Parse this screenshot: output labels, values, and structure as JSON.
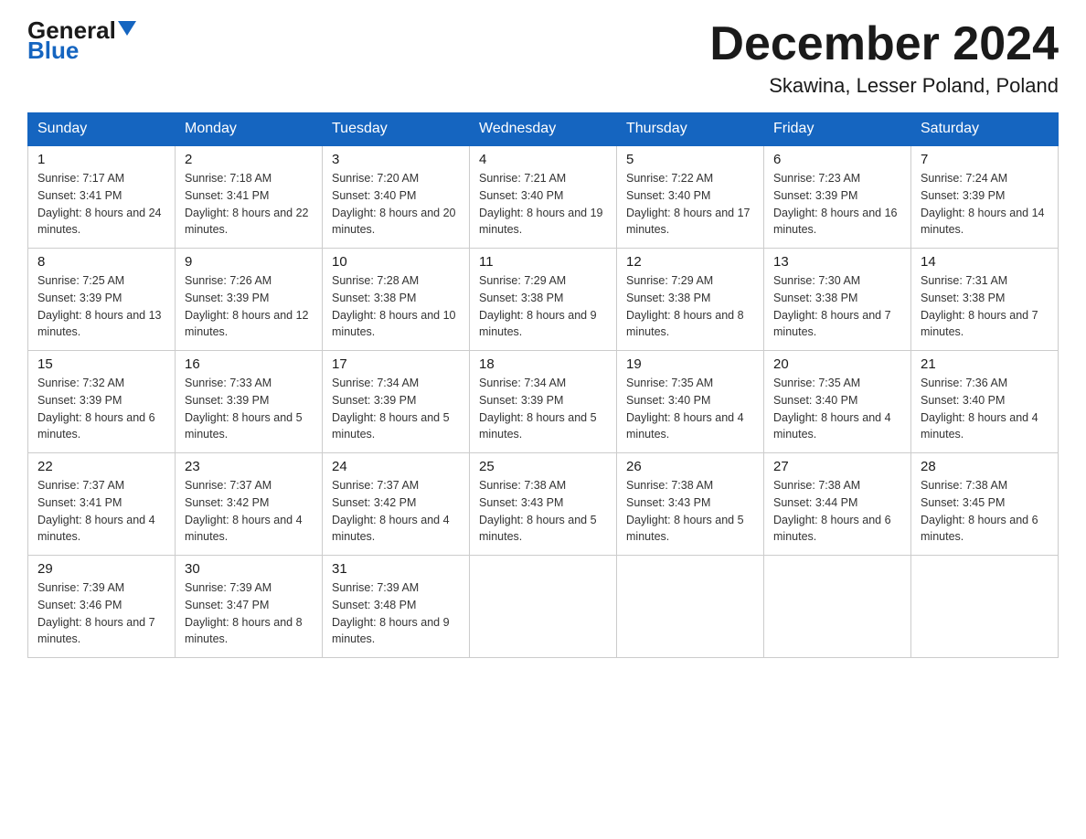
{
  "header": {
    "logo_general": "General",
    "logo_blue": "Blue",
    "title": "December 2024",
    "subtitle": "Skawina, Lesser Poland, Poland"
  },
  "columns": [
    "Sunday",
    "Monday",
    "Tuesday",
    "Wednesday",
    "Thursday",
    "Friday",
    "Saturday"
  ],
  "weeks": [
    [
      {
        "day": "1",
        "sunrise": "7:17 AM",
        "sunset": "3:41 PM",
        "daylight": "8 hours and 24 minutes."
      },
      {
        "day": "2",
        "sunrise": "7:18 AM",
        "sunset": "3:41 PM",
        "daylight": "8 hours and 22 minutes."
      },
      {
        "day": "3",
        "sunrise": "7:20 AM",
        "sunset": "3:40 PM",
        "daylight": "8 hours and 20 minutes."
      },
      {
        "day": "4",
        "sunrise": "7:21 AM",
        "sunset": "3:40 PM",
        "daylight": "8 hours and 19 minutes."
      },
      {
        "day": "5",
        "sunrise": "7:22 AM",
        "sunset": "3:40 PM",
        "daylight": "8 hours and 17 minutes."
      },
      {
        "day": "6",
        "sunrise": "7:23 AM",
        "sunset": "3:39 PM",
        "daylight": "8 hours and 16 minutes."
      },
      {
        "day": "7",
        "sunrise": "7:24 AM",
        "sunset": "3:39 PM",
        "daylight": "8 hours and 14 minutes."
      }
    ],
    [
      {
        "day": "8",
        "sunrise": "7:25 AM",
        "sunset": "3:39 PM",
        "daylight": "8 hours and 13 minutes."
      },
      {
        "day": "9",
        "sunrise": "7:26 AM",
        "sunset": "3:39 PM",
        "daylight": "8 hours and 12 minutes."
      },
      {
        "day": "10",
        "sunrise": "7:28 AM",
        "sunset": "3:38 PM",
        "daylight": "8 hours and 10 minutes."
      },
      {
        "day": "11",
        "sunrise": "7:29 AM",
        "sunset": "3:38 PM",
        "daylight": "8 hours and 9 minutes."
      },
      {
        "day": "12",
        "sunrise": "7:29 AM",
        "sunset": "3:38 PM",
        "daylight": "8 hours and 8 minutes."
      },
      {
        "day": "13",
        "sunrise": "7:30 AM",
        "sunset": "3:38 PM",
        "daylight": "8 hours and 7 minutes."
      },
      {
        "day": "14",
        "sunrise": "7:31 AM",
        "sunset": "3:38 PM",
        "daylight": "8 hours and 7 minutes."
      }
    ],
    [
      {
        "day": "15",
        "sunrise": "7:32 AM",
        "sunset": "3:39 PM",
        "daylight": "8 hours and 6 minutes."
      },
      {
        "day": "16",
        "sunrise": "7:33 AM",
        "sunset": "3:39 PM",
        "daylight": "8 hours and 5 minutes."
      },
      {
        "day": "17",
        "sunrise": "7:34 AM",
        "sunset": "3:39 PM",
        "daylight": "8 hours and 5 minutes."
      },
      {
        "day": "18",
        "sunrise": "7:34 AM",
        "sunset": "3:39 PM",
        "daylight": "8 hours and 5 minutes."
      },
      {
        "day": "19",
        "sunrise": "7:35 AM",
        "sunset": "3:40 PM",
        "daylight": "8 hours and 4 minutes."
      },
      {
        "day": "20",
        "sunrise": "7:35 AM",
        "sunset": "3:40 PM",
        "daylight": "8 hours and 4 minutes."
      },
      {
        "day": "21",
        "sunrise": "7:36 AM",
        "sunset": "3:40 PM",
        "daylight": "8 hours and 4 minutes."
      }
    ],
    [
      {
        "day": "22",
        "sunrise": "7:37 AM",
        "sunset": "3:41 PM",
        "daylight": "8 hours and 4 minutes."
      },
      {
        "day": "23",
        "sunrise": "7:37 AM",
        "sunset": "3:42 PM",
        "daylight": "8 hours and 4 minutes."
      },
      {
        "day": "24",
        "sunrise": "7:37 AM",
        "sunset": "3:42 PM",
        "daylight": "8 hours and 4 minutes."
      },
      {
        "day": "25",
        "sunrise": "7:38 AM",
        "sunset": "3:43 PM",
        "daylight": "8 hours and 5 minutes."
      },
      {
        "day": "26",
        "sunrise": "7:38 AM",
        "sunset": "3:43 PM",
        "daylight": "8 hours and 5 minutes."
      },
      {
        "day": "27",
        "sunrise": "7:38 AM",
        "sunset": "3:44 PM",
        "daylight": "8 hours and 6 minutes."
      },
      {
        "day": "28",
        "sunrise": "7:38 AM",
        "sunset": "3:45 PM",
        "daylight": "8 hours and 6 minutes."
      }
    ],
    [
      {
        "day": "29",
        "sunrise": "7:39 AM",
        "sunset": "3:46 PM",
        "daylight": "8 hours and 7 minutes."
      },
      {
        "day": "30",
        "sunrise": "7:39 AM",
        "sunset": "3:47 PM",
        "daylight": "8 hours and 8 minutes."
      },
      {
        "day": "31",
        "sunrise": "7:39 AM",
        "sunset": "3:48 PM",
        "daylight": "8 hours and 9 minutes."
      },
      null,
      null,
      null,
      null
    ]
  ]
}
